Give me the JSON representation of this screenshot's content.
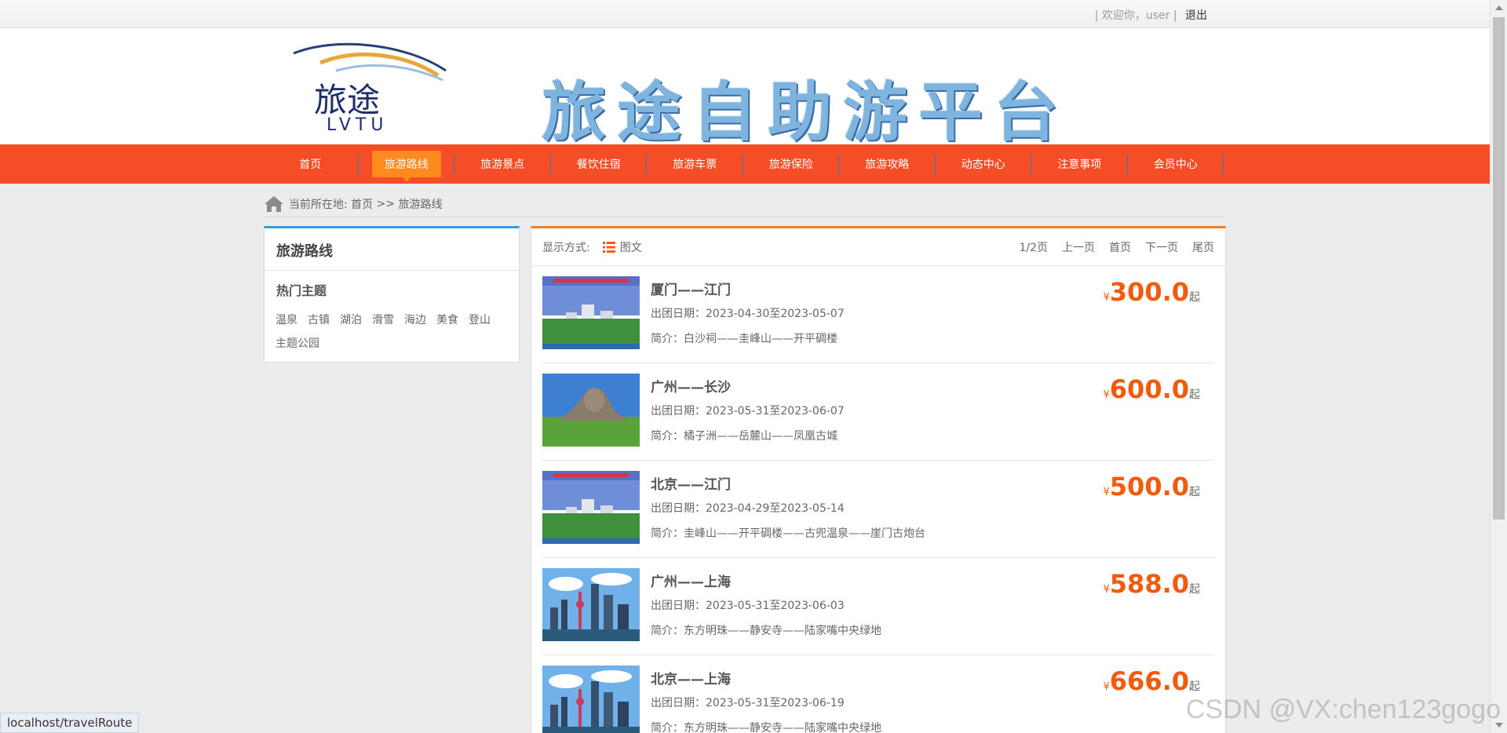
{
  "topbar": {
    "welcome": "| 欢迎你，user |",
    "logout": "退出"
  },
  "header": {
    "logo_text": "旅途",
    "logo_sub": "LVTU",
    "banner": "旅途自助游平台"
  },
  "nav": {
    "items": [
      {
        "label": "首页",
        "active": false
      },
      {
        "label": "旅游路线",
        "active": true
      },
      {
        "label": "旅游景点",
        "active": false
      },
      {
        "label": "餐饮住宿",
        "active": false
      },
      {
        "label": "旅游车票",
        "active": false
      },
      {
        "label": "旅游保险",
        "active": false
      },
      {
        "label": "旅游攻略",
        "active": false
      },
      {
        "label": "动态中心",
        "active": false
      },
      {
        "label": "注意事项",
        "active": false
      },
      {
        "label": "会员中心",
        "active": false
      }
    ]
  },
  "breadcrumb": {
    "prefix": "当前所在地:",
    "home": "首页",
    "sep": ">>",
    "current": "旅游路线"
  },
  "sidebar": {
    "title": "旅游路线",
    "subtitle": "热门主题",
    "tags": [
      "温泉",
      "古镇",
      "湖泊",
      "滑雪",
      "海边",
      "美食",
      "登山",
      "主题公园"
    ]
  },
  "toolbar": {
    "display_label": "显示方式:",
    "mode": "图文",
    "pages": "1/2页",
    "prev": "上一页",
    "first": "首页",
    "next": "下一页",
    "last": "尾页"
  },
  "routes": [
    {
      "title": "厦门——江门",
      "date": "出团日期：2023-04-30至2023-05-07",
      "intro": "简介：白沙祠——圭峰山——开平碉楼",
      "yen": "¥",
      "price": "300.0",
      "suffix": "起",
      "image": "campus-icon"
    },
    {
      "title": "广州——长沙",
      "date": "出团日期：2023-05-31至2023-06-07",
      "intro": "简介：橘子洲——岳麓山——凤凰古城",
      "yen": "¥",
      "price": "600.0",
      "suffix": "起",
      "image": "statue-icon"
    },
    {
      "title": "北京——江门",
      "date": "出团日期：2023-04-29至2023-05-14",
      "intro": "简介：圭峰山——开平碉楼——古兜温泉——崖门古炮台",
      "yen": "¥",
      "price": "500.0",
      "suffix": "起",
      "image": "campus-icon"
    },
    {
      "title": "广州——上海",
      "date": "出团日期：2023-05-31至2023-06-03",
      "intro": "简介：东方明珠——静安寺——陆家嘴中央绿地",
      "yen": "¥",
      "price": "588.0",
      "suffix": "起",
      "image": "skyline-icon"
    },
    {
      "title": "北京——上海",
      "date": "出团日期：2023-05-31至2023-06-19",
      "intro": "简介：东方明珠——静安寺——陆家嘴中央绿地",
      "yen": "¥",
      "price": "666.0",
      "suffix": "起",
      "image": "skyline-icon"
    }
  ],
  "status_url": "localhost/travelRoute",
  "watermark": "CSDN @VX:chen123gogo"
}
